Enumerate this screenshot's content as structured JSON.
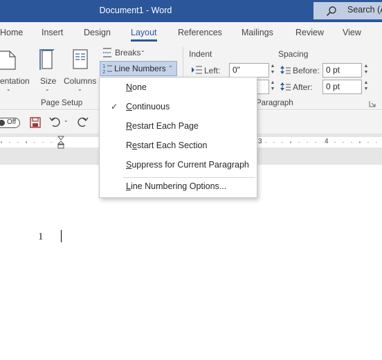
{
  "window": {
    "title": "Document1  -  Word",
    "search_label": "Search (A"
  },
  "tabs": [
    {
      "label": "Home",
      "active": false
    },
    {
      "label": "Insert",
      "active": false
    },
    {
      "label": "Design",
      "active": false
    },
    {
      "label": "Layout",
      "active": true
    },
    {
      "label": "References",
      "active": false
    },
    {
      "label": "Mailings",
      "active": false
    },
    {
      "label": "Review",
      "active": false
    },
    {
      "label": "View",
      "active": false
    }
  ],
  "ribbon": {
    "page_setup": {
      "orientation_label": "entation",
      "size_label": "Size",
      "columns_label": "Columns",
      "breaks_label": "Breaks",
      "line_numbers_label": "Line Numbers",
      "group_label": "Page Setup"
    },
    "paragraph": {
      "indent_label": "Indent",
      "left_label": "Left:",
      "left_value": "0\"",
      "spacing_label": "Spacing",
      "before_label": "Before:",
      "before_value": "0 pt",
      "after_label": "After:",
      "after_value": "0 pt",
      "group_label": "Paragraph"
    }
  },
  "quick_access": {
    "autosave_label": "Off"
  },
  "ruler": {
    "marks": [
      "3",
      "4"
    ]
  },
  "line_numbers_menu": {
    "items": [
      {
        "label": "None",
        "mnemonic": "N",
        "checked": false
      },
      {
        "label": "Continuous",
        "mnemonic": "C",
        "checked": true
      },
      {
        "label": "Restart Each Page",
        "mnemonic": "R",
        "checked": false
      },
      {
        "label": "Restart Each Section",
        "mnemonic": "e",
        "checked": false
      },
      {
        "label": "Suppress for Current Paragraph",
        "mnemonic": "S",
        "checked": false
      }
    ],
    "options_label": "Line Numbering Options...",
    "options_mnemonic": "L",
    "check_glyph": "✓"
  },
  "document": {
    "line_number": "1"
  },
  "colors": {
    "title_bar": "#2b579a",
    "ribbon_bg": "#f3f3f3",
    "accent": "#2b579a",
    "selected_button": "#c5d3e8"
  }
}
